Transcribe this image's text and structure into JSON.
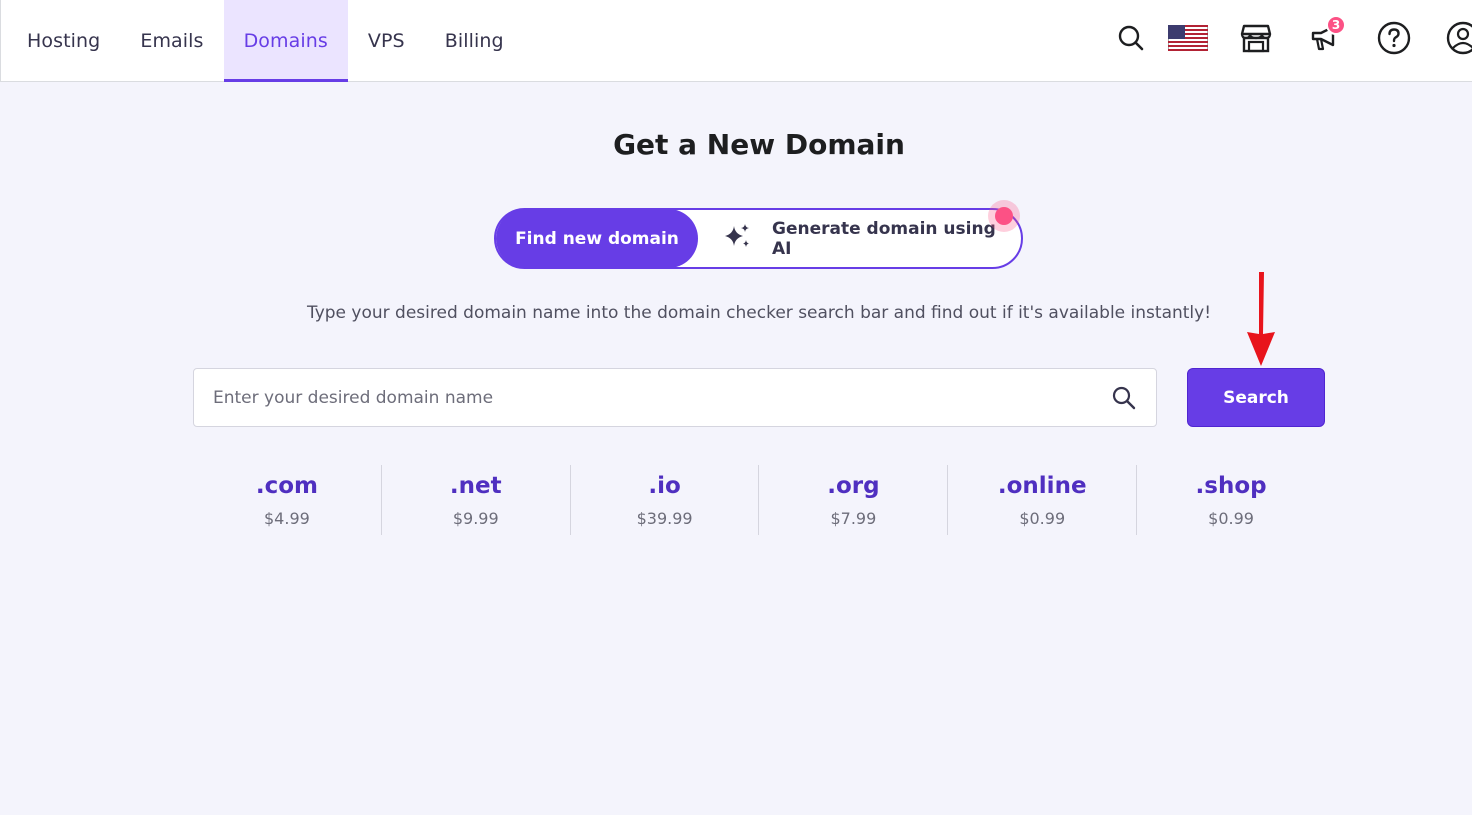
{
  "nav": {
    "tabs": [
      {
        "label": "Hosting",
        "active": false
      },
      {
        "label": "Emails",
        "active": false
      },
      {
        "label": "Domains",
        "active": true
      },
      {
        "label": "VPS",
        "active": false
      },
      {
        "label": "Billing",
        "active": false
      }
    ]
  },
  "header_icons": {
    "search": "search-icon",
    "language": "us-flag-icon",
    "store": "store-icon",
    "notifications": "megaphone-icon",
    "notifications_count": "3",
    "help": "help-icon",
    "account": "account-icon"
  },
  "page": {
    "title": "Get a New Domain",
    "toggle": {
      "find_label": "Find new domain",
      "ai_label": "Generate domain using AI",
      "ai_icon": "sparkles-icon"
    },
    "subtitle": "Type your desired domain name into the domain checker search bar and find out if it's available instantly!",
    "search": {
      "placeholder": "Enter your desired domain name",
      "value": "",
      "button_label": "Search"
    },
    "tlds": [
      {
        "name": ".com",
        "price": "$4.99"
      },
      {
        "name": ".net",
        "price": "$9.99"
      },
      {
        "name": ".io",
        "price": "$39.99"
      },
      {
        "name": ".org",
        "price": "$7.99"
      },
      {
        "name": ".online",
        "price": "$0.99"
      },
      {
        "name": ".shop",
        "price": "$0.99"
      }
    ]
  },
  "colors": {
    "accent": "#673de6",
    "accent_light": "#ebe4ff",
    "badge": "#fc5185",
    "background": "#f4f4fc",
    "annotation_arrow": "#e8141c"
  }
}
